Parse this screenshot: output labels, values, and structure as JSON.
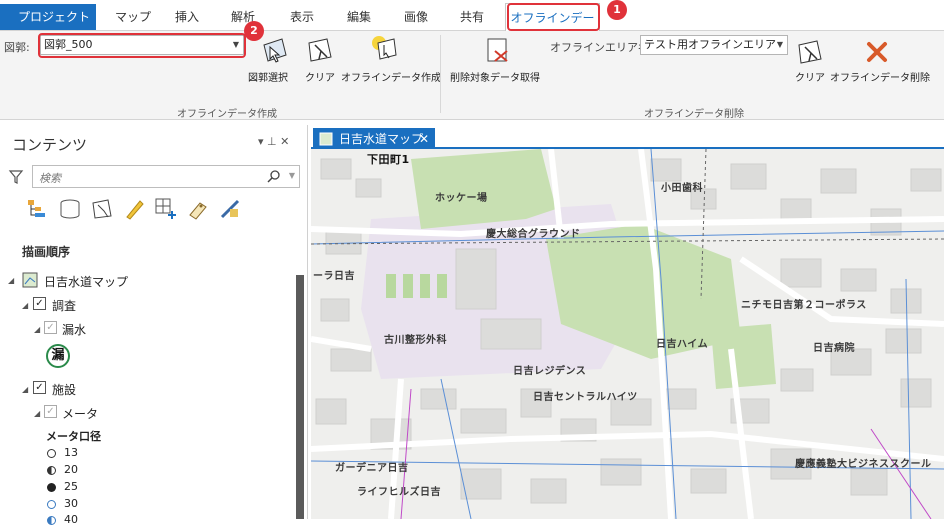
{
  "tabs": {
    "project": "プロジェクト",
    "items": [
      "マップ",
      "挿入",
      "解析",
      "表示",
      "編集",
      "画像",
      "共有"
    ],
    "active": "オフラインデータ"
  },
  "callouts": {
    "one": "1",
    "two": "2"
  },
  "ribbon": {
    "zukaku_label": "図郭:",
    "zukaku_value": "図郭_500",
    "btn_select": "図郭選択",
    "btn_clear1": "クリア",
    "btn_create": "オフラインデータ作成",
    "btn_getdel": "削除対象データ取得",
    "area_label": "オフラインエリア名:",
    "area_value": "テスト用オフラインエリア",
    "btn_clear2": "クリア",
    "btn_delete": "オフラインデータ削除",
    "group_create": "オフラインデータ作成",
    "group_delete": "オフラインデータ削除"
  },
  "contents": {
    "title": "コンテンツ",
    "pin": "▾ ⊥ ✕",
    "search_placeholder": "検索",
    "draw_order": "描画順序",
    "map_name": "日吉水道マップ",
    "group1": "調査",
    "layer1": "漏水",
    "leak_symbol": "漏",
    "group2": "施設",
    "layer2": "メータ",
    "legend_title": "メータ口径",
    "legend": [
      "13",
      "20",
      "25",
      "30",
      "40"
    ]
  },
  "map": {
    "tab_label": "日吉水道マップ",
    "close": "✕",
    "labels": [
      "下田町1",
      "ホッケー場",
      "小田歯科",
      "慶大総合グラウンド",
      "ーラ日吉",
      "ニチモ日吉第２コーポラス",
      "古川整形外科",
      "日吉ハイム",
      "日吉病院",
      "日吉レジデンス",
      "日吉セントラルハイツ",
      "ガーデニア日吉",
      "慶應義塾大ビジネススクール",
      "ライフヒルズ日吉"
    ]
  },
  "colors": {
    "accent": "#1a6fc0",
    "callout": "#e0323a",
    "green": "#c8e0b2"
  }
}
